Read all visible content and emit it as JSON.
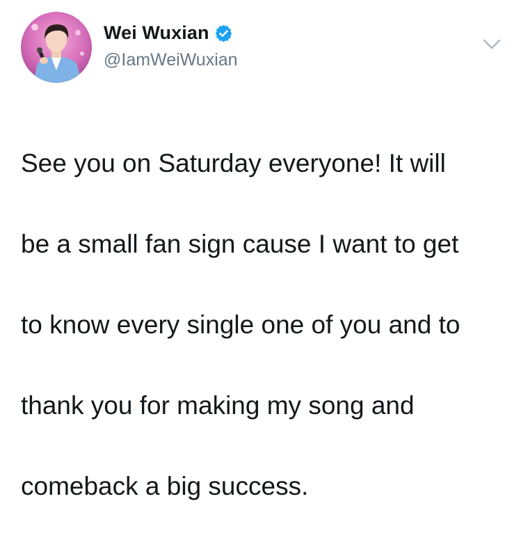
{
  "author": {
    "display_name": "Wei Wuxian",
    "handle": "@IamWeiWuxian",
    "verified": true
  },
  "icons": {
    "verified": "verified-badge-icon",
    "menu": "chevron-down-icon"
  },
  "colors": {
    "text": "#14171a",
    "secondary_text": "#657786",
    "verified_blue": "#1da1f2",
    "caret_gray": "#aab8c2"
  },
  "tweet": {
    "lines": [
      "See you on Saturday everyone! It will",
      "be a small fan sign cause I want to get",
      "to know every single one of you and to",
      "thank you for making my song and",
      "comeback a big success."
    ]
  }
}
